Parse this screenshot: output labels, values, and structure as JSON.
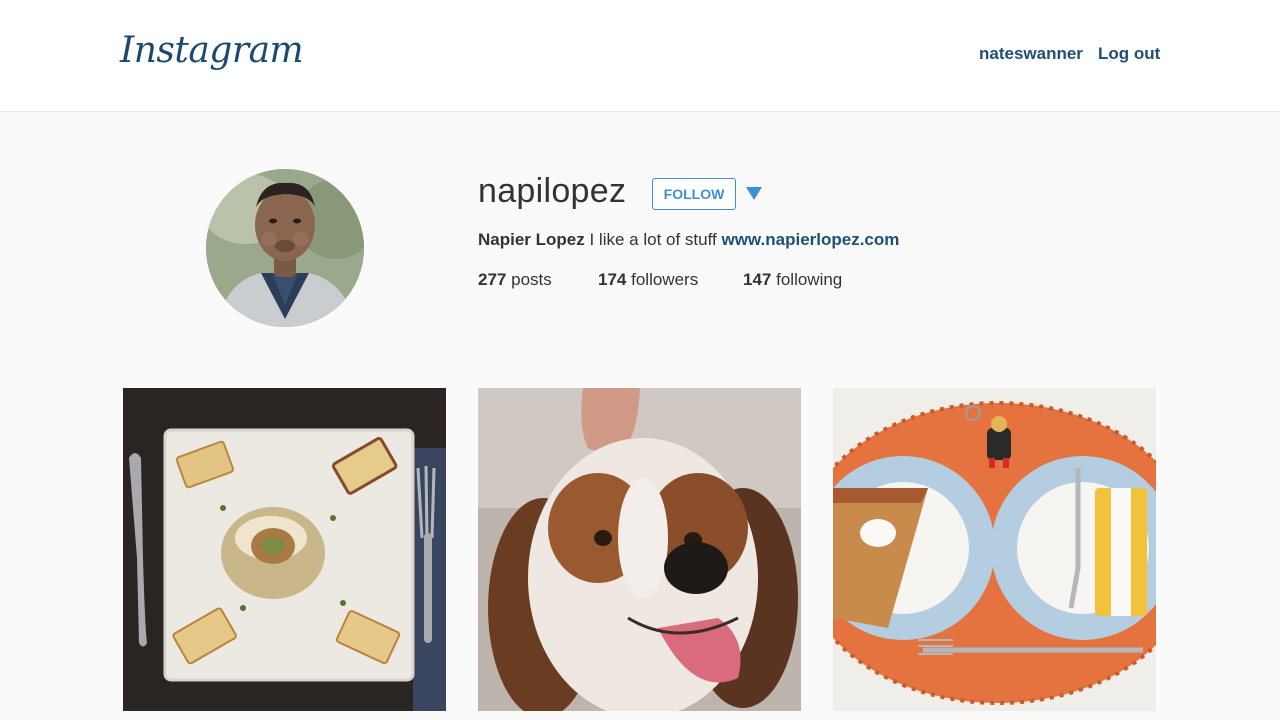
{
  "header": {
    "logo_text": "Instagram",
    "nav_user": "nateswanner",
    "logout_label": "Log out"
  },
  "profile": {
    "username": "napilopez",
    "follow_label": "FOLLOW",
    "full_name": "Napier Lopez",
    "bio": "I like a lot of stuff",
    "website": "www.napierlopez.com",
    "stats": {
      "posts_count": "277",
      "posts_label": "posts",
      "followers_count": "174",
      "followers_label": "followers",
      "following_count": "147",
      "following_label": "following"
    }
  },
  "colors": {
    "brand": "#1b4a70",
    "link": "#1f4f78",
    "accent": "#3f8fd4",
    "background": "#fafafa"
  }
}
